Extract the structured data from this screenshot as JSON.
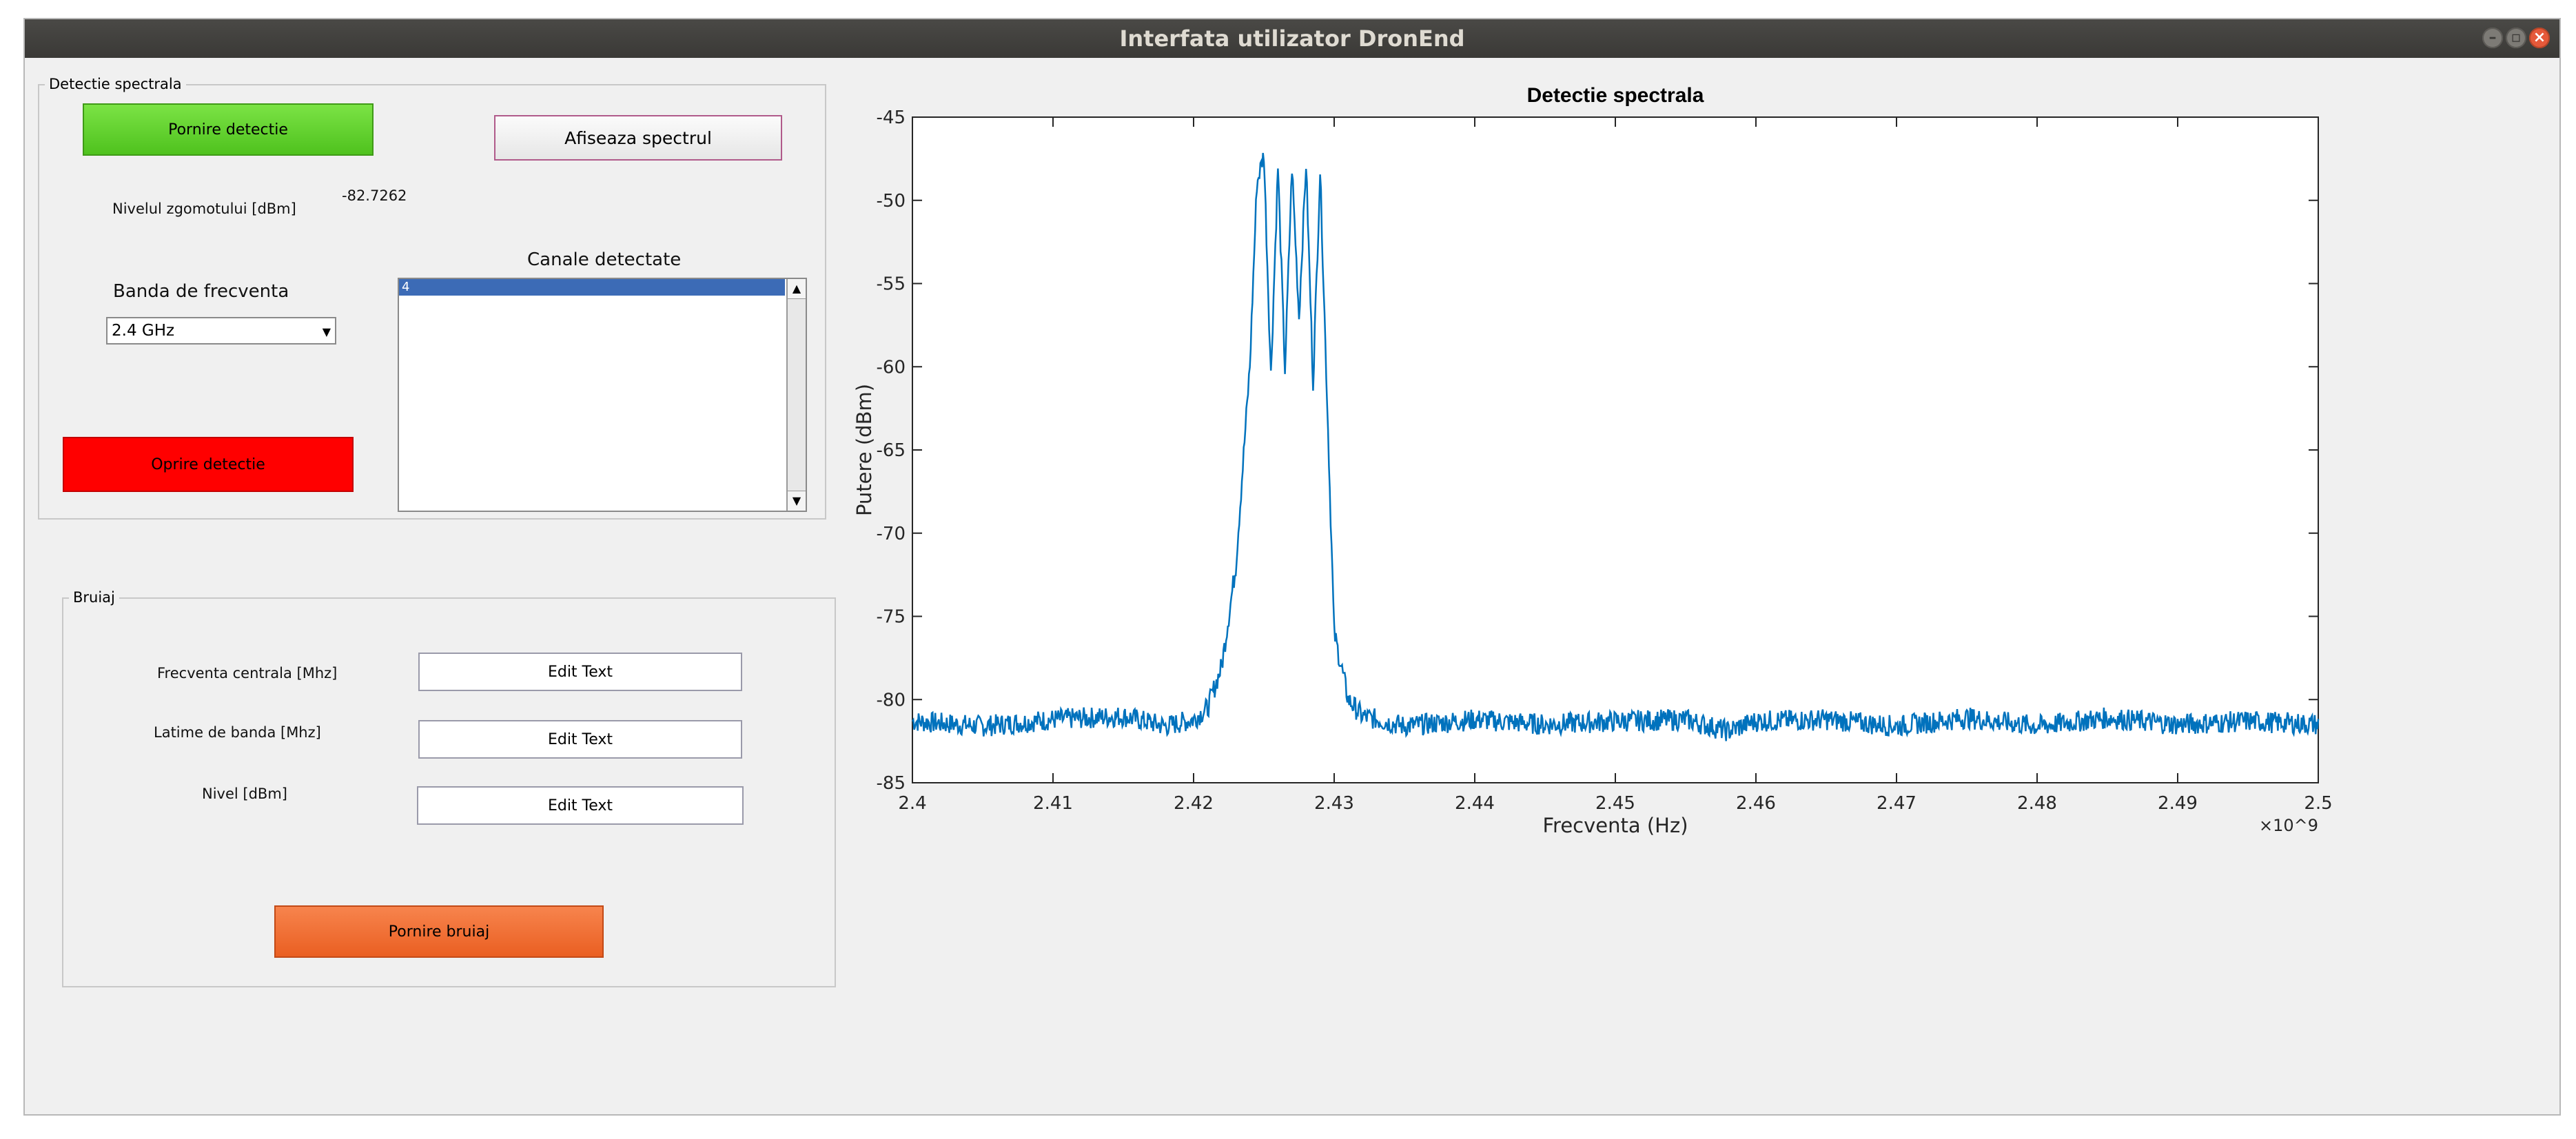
{
  "window": {
    "title": "Interfata utilizator DronEnd"
  },
  "detection_panel": {
    "title": "Detectie spectrala",
    "start_label": "Pornire detectie",
    "show_spectrum_label": "Afiseaza spectrul",
    "noise_label": "Nivelul zgomotului [dBm]",
    "noise_value": "-82.7262",
    "band_label": "Banda de frecventa",
    "band_selected": "2.4 GHz",
    "channels_label": "Canale detectate",
    "channels": [
      "4"
    ],
    "stop_label": "Oprire detectie"
  },
  "jamming_panel": {
    "title": "Bruiaj",
    "center_freq_label": "Frecventa centrala [Mhz]",
    "center_freq_value": "Edit Text",
    "bandwidth_label": "Latime de banda [Mhz]",
    "bandwidth_value": "Edit Text",
    "level_label": "Nivel [dBm]",
    "level_value": "Edit Text",
    "start_label": "Pornire bruiaj"
  },
  "colors": {
    "start_green": "#5fd32b",
    "stop_red": "#ff0000",
    "jam_orange": "#f26a2e",
    "series": "#0072bd",
    "selection": "#3c6bb6"
  },
  "chart_data": {
    "type": "line",
    "title": "Detectie spectrala",
    "xlabel": "Frecventa (Hz)",
    "ylabel": "Putere (dBm)",
    "x_exponent_label": "×10^9",
    "xlim": [
      2.4,
      2.5
    ],
    "ylim": [
      -85,
      -45
    ],
    "xticks": [
      "2.4",
      "2.41",
      "2.42",
      "2.43",
      "2.44",
      "2.45",
      "2.46",
      "2.47",
      "2.48",
      "2.49",
      "2.5"
    ],
    "yticks": [
      "-45",
      "-50",
      "-55",
      "-60",
      "-65",
      "-70",
      "-75",
      "-80",
      "-85"
    ],
    "grid": false,
    "series": [
      {
        "x": [
          2.4,
          2.405,
          2.41,
          2.415,
          2.418,
          2.42,
          2.421,
          2.422,
          2.423,
          2.424,
          2.4245,
          2.425,
          2.4255,
          2.426,
          2.4265,
          2.427,
          2.4275,
          2.428,
          2.4285,
          2.429,
          2.4295,
          2.43,
          2.431,
          2.432,
          2.435,
          2.44,
          2.445,
          2.45,
          2.455,
          2.458,
          2.46,
          2.465,
          2.47,
          2.475,
          2.48,
          2.485,
          2.49,
          2.495,
          2.5
        ],
        "y": [
          -81.3,
          -81.6,
          -81.2,
          -81.0,
          -81.6,
          -81.2,
          -80.5,
          -78.0,
          -72.0,
          -60.0,
          -49.0,
          -47.2,
          -60.5,
          -48.0,
          -60.2,
          -48.0,
          -57.0,
          -47.8,
          -61.0,
          -48.2,
          -62.0,
          -76.0,
          -80.0,
          -81.0,
          -81.6,
          -81.2,
          -81.5,
          -81.3,
          -81.2,
          -81.9,
          -81.3,
          -81.2,
          -81.6,
          -81.1,
          -81.6,
          -81.1,
          -81.5,
          -81.3,
          -81.5
        ]
      }
    ]
  }
}
